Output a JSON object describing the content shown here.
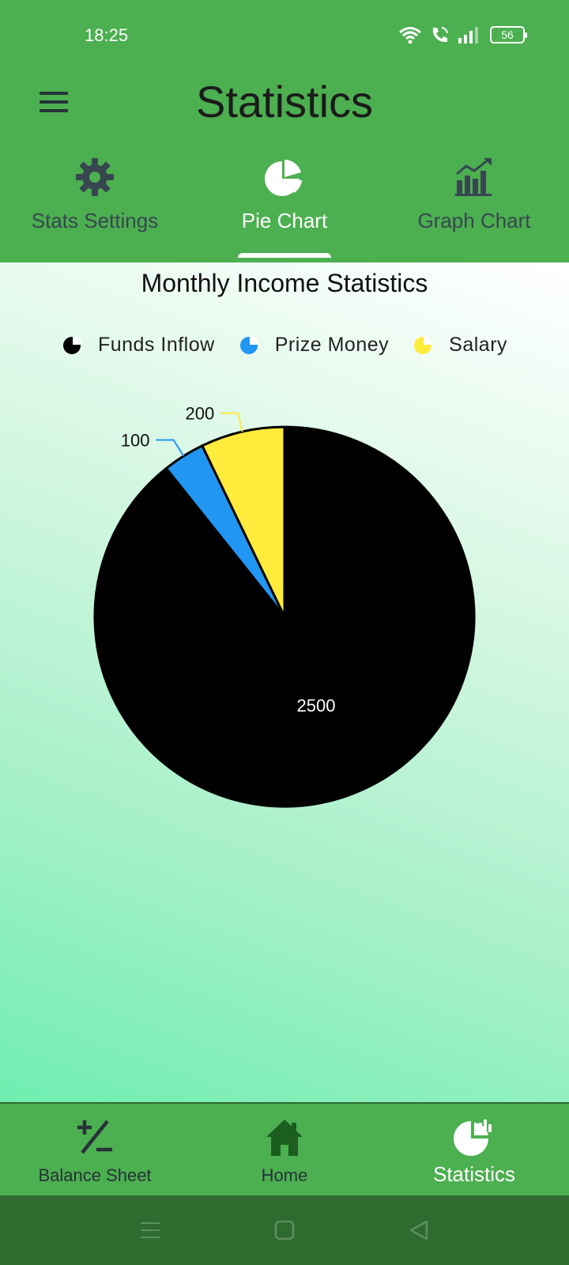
{
  "status_bar": {
    "time": "18:25",
    "battery": "56",
    "icons": [
      "wifi-icon",
      "call-icon",
      "signal-icon",
      "battery-icon"
    ]
  },
  "app_bar": {
    "title": "Statistics",
    "menu_icon": "hamburger-menu-icon"
  },
  "tabs": [
    {
      "label": "Stats Settings",
      "icon": "gear-icon",
      "active": false
    },
    {
      "label": "Pie Chart",
      "icon": "pie-chart-icon",
      "active": true
    },
    {
      "label": "Graph Chart",
      "icon": "bar-graph-icon",
      "active": false
    }
  ],
  "colors": {
    "primary": "#4caf50",
    "dark": "#2e6b2f",
    "funds_inflow": "#000000",
    "prize_money": "#2196f3",
    "salary": "#ffeb3b"
  },
  "chart_data": {
    "type": "pie",
    "title": "Monthly Income Statistics",
    "legend_position": "top",
    "categories": [
      "Funds Inflow",
      "Prize Money",
      "Salary"
    ],
    "values": [
      2500,
      100,
      200
    ],
    "colors": [
      "#000000",
      "#2196f3",
      "#ffeb3b"
    ],
    "data_labels": [
      "2500",
      "100",
      "200"
    ]
  },
  "bottom_nav": [
    {
      "label": "Balance Sheet",
      "icon": "plus-minus-icon",
      "active": false
    },
    {
      "label": "Home",
      "icon": "home-icon",
      "active": false
    },
    {
      "label": "Statistics",
      "icon": "statistics-icon",
      "active": true
    }
  ],
  "system_nav": [
    "recents-button",
    "home-button",
    "back-button"
  ]
}
